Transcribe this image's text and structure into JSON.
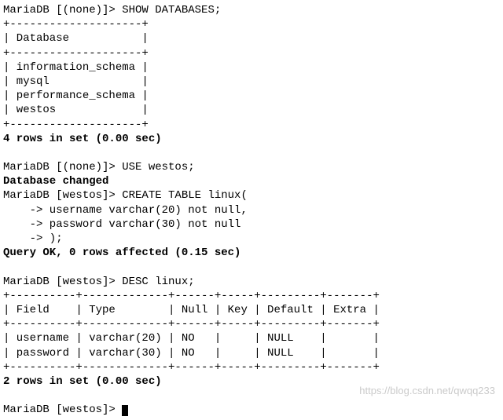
{
  "block1": {
    "prompt_cmd": "MariaDB [(none)]> SHOW DATABASES;",
    "border": "+--------------------+",
    "header": "| Database           |",
    "rows": [
      "| information_schema |",
      "| mysql              |",
      "| performance_schema |",
      "| westos             |"
    ],
    "footer": "4 rows in set (0.00 sec)"
  },
  "block2": {
    "prompt_cmd": "MariaDB [(none)]> USE westos;",
    "response": "Database changed",
    "create_lines": [
      "MariaDB [westos]> CREATE TABLE linux(",
      "    -> username varchar(20) not null,",
      "    -> password varchar(30) not null",
      "    -> );"
    ],
    "result": "Query OK, 0 rows affected (0.15 sec)"
  },
  "block3": {
    "prompt_cmd": "MariaDB [westos]> DESC linux;",
    "border": "+----------+-------------+------+-----+---------+-------+",
    "header": "| Field    | Type        | Null | Key | Default | Extra |",
    "rows": [
      "| username | varchar(20) | NO   |     | NULL    |       |",
      "| password | varchar(30) | NO   |     | NULL    |       |"
    ],
    "footer": "2 rows in set (0.00 sec)"
  },
  "final_prompt": "MariaDB [westos]> ",
  "watermark": "https://blog.csdn.net/qwqq233"
}
